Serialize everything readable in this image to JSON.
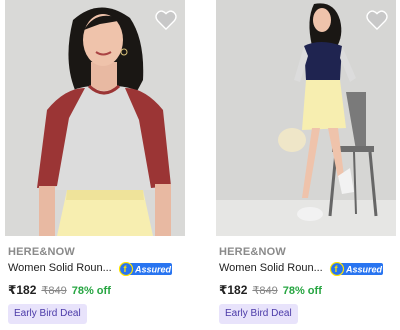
{
  "products": [
    {
      "brand": "HERE&NOW",
      "title": "Women Solid Roun...",
      "assured_label": "Assured",
      "price": "₹182",
      "mrp": "₹849",
      "discount": "78% off",
      "deal_badge": "Early Bird Deal"
    },
    {
      "brand": "HERE&NOW",
      "title": "Women Solid Roun...",
      "assured_label": "Assured",
      "price": "₹182",
      "mrp": "₹849",
      "discount": "78% off",
      "deal_badge": "Early Bird Deal"
    }
  ],
  "colors": {
    "assured_blue": "#2874f0",
    "discount_green": "#26a541",
    "deal_bg": "#e8e3fb"
  }
}
